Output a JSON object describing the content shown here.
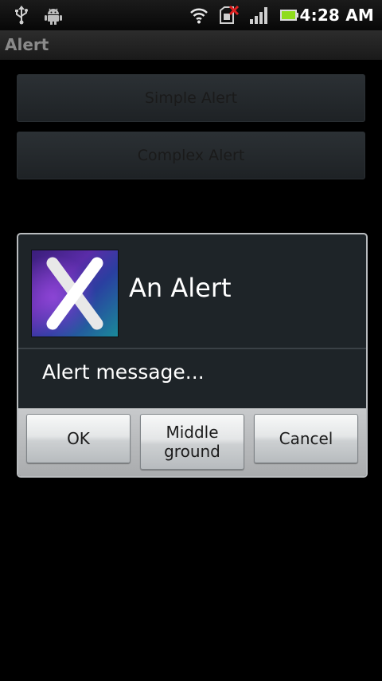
{
  "status_bar": {
    "time": "4:28 AM",
    "icons": [
      "usb-icon",
      "android-debug-icon",
      "wifi-icon",
      "no-sim-icon",
      "signal-icon",
      "battery-icon"
    ]
  },
  "title_bar": {
    "title": "Alert"
  },
  "main": {
    "buttons": [
      {
        "label": "Simple Alert"
      },
      {
        "label": "Complex Alert"
      }
    ]
  },
  "dialog": {
    "icon": "app-x-icon",
    "title": "An Alert",
    "message": "Alert message...",
    "buttons": {
      "positive": "OK",
      "neutral_line1": "Middle",
      "neutral_line2": "ground",
      "negative": "Cancel"
    }
  },
  "colors": {
    "background": "#000000",
    "dialog_bg": "#1e2428",
    "dialog_border": "#b9bcbf",
    "button_panel": "#c8cacc",
    "title_gray": "#8a8a8a"
  }
}
